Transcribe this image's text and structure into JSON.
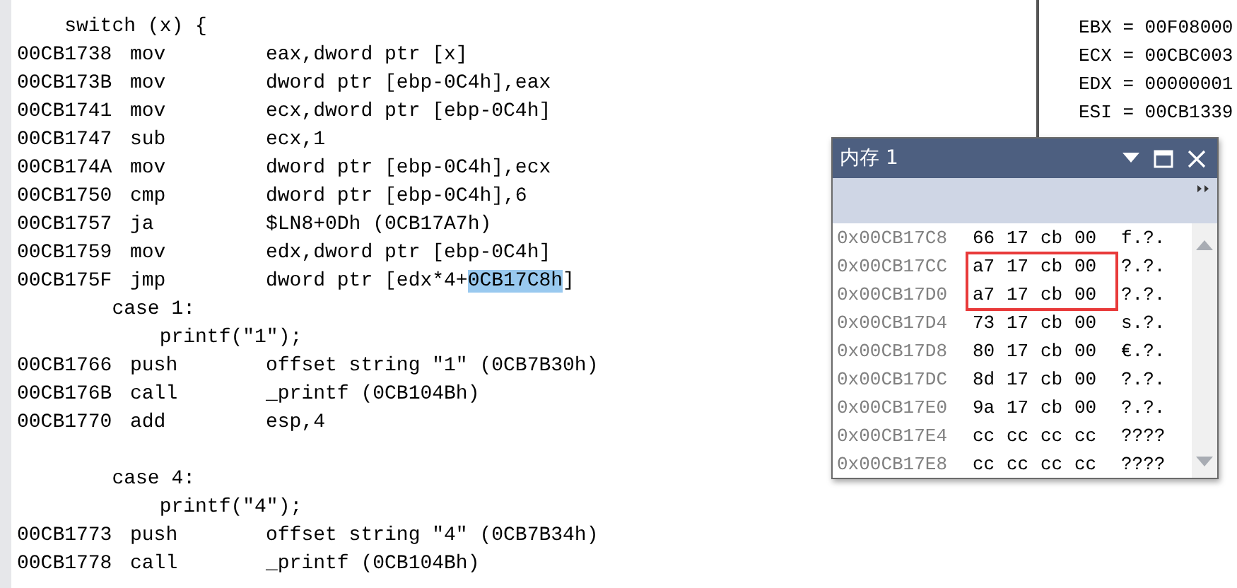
{
  "disassembly": {
    "lines": [
      {
        "kind": "source",
        "text": "    switch (x) {"
      },
      {
        "kind": "asm",
        "address": "00CB1738",
        "mnemonic": "mov",
        "operands": [
          {
            "text": "eax,dword ptr [x]",
            "selected": false
          }
        ]
      },
      {
        "kind": "asm",
        "address": "00CB173B",
        "mnemonic": "mov",
        "operands": [
          {
            "text": "dword ptr [ebp-0C4h],eax",
            "selected": false
          }
        ]
      },
      {
        "kind": "asm",
        "address": "00CB1741",
        "mnemonic": "mov",
        "operands": [
          {
            "text": "ecx,dword ptr [ebp-0C4h]",
            "selected": false
          }
        ]
      },
      {
        "kind": "asm",
        "address": "00CB1747",
        "mnemonic": "sub",
        "operands": [
          {
            "text": "ecx,1",
            "selected": false
          }
        ]
      },
      {
        "kind": "asm",
        "address": "00CB174A",
        "mnemonic": "mov",
        "operands": [
          {
            "text": "dword ptr [ebp-0C4h],ecx",
            "selected": false
          }
        ]
      },
      {
        "kind": "asm",
        "address": "00CB1750",
        "mnemonic": "cmp",
        "operands": [
          {
            "text": "dword ptr [ebp-0C4h],6",
            "selected": false
          }
        ]
      },
      {
        "kind": "asm",
        "address": "00CB1757",
        "mnemonic": "ja",
        "operands": [
          {
            "text": "$LN8+0Dh (0CB17A7h)",
            "selected": false
          }
        ]
      },
      {
        "kind": "asm",
        "address": "00CB1759",
        "mnemonic": "mov",
        "operands": [
          {
            "text": "edx,dword ptr [ebp-0C4h]",
            "selected": false
          }
        ]
      },
      {
        "kind": "asm",
        "address": "00CB175F",
        "mnemonic": "jmp",
        "operands": [
          {
            "text": "dword ptr [edx*4+",
            "selected": false
          },
          {
            "text": "0CB17C8h",
            "selected": true
          },
          {
            "text": "]",
            "selected": false
          }
        ]
      },
      {
        "kind": "source",
        "text": "        case 1:"
      },
      {
        "kind": "source",
        "text": "            printf(″1″);"
      },
      {
        "kind": "asm",
        "address": "00CB1766",
        "mnemonic": "push",
        "operands": [
          {
            "text": "offset string ″1″ (0CB7B30h)",
            "selected": false
          }
        ]
      },
      {
        "kind": "asm",
        "address": "00CB176B",
        "mnemonic": "call",
        "operands": [
          {
            "text": "_printf (0CB104Bh)",
            "selected": false
          }
        ]
      },
      {
        "kind": "asm",
        "address": "00CB1770",
        "mnemonic": "add",
        "operands": [
          {
            "text": "esp,4",
            "selected": false
          }
        ]
      },
      {
        "kind": "blank"
      },
      {
        "kind": "source",
        "text": "        case 4:"
      },
      {
        "kind": "source",
        "text": "            printf(″4″);"
      },
      {
        "kind": "asm",
        "address": "00CB1773",
        "mnemonic": "push",
        "operands": [
          {
            "text": "offset string ″4″ (0CB7B34h)",
            "selected": false
          }
        ]
      },
      {
        "kind": "asm",
        "address": "00CB1778",
        "mnemonic": "call",
        "operands": [
          {
            "text": "_printf (0CB104Bh)",
            "selected": false
          }
        ]
      }
    ]
  },
  "registers": [
    "EBX = 00F08000",
    "ECX = 00CBC003",
    "EDX = 00000001",
    "ESI = 00CB1339"
  ],
  "memory_window": {
    "title": "内存 1",
    "rows": [
      {
        "address": "0x00CB17C8",
        "bytes": [
          "66",
          "17",
          "cb",
          "00"
        ],
        "chars": "f.?.",
        "boxed": false
      },
      {
        "address": "0x00CB17CC",
        "bytes": [
          "a7",
          "17",
          "cb",
          "00"
        ],
        "chars": "?.?.",
        "boxed": true
      },
      {
        "address": "0x00CB17D0",
        "bytes": [
          "a7",
          "17",
          "cb",
          "00"
        ],
        "chars": "?.?.",
        "boxed": true
      },
      {
        "address": "0x00CB17D4",
        "bytes": [
          "73",
          "17",
          "cb",
          "00"
        ],
        "chars": "s.?.",
        "boxed": false
      },
      {
        "address": "0x00CB17D8",
        "bytes": [
          "80",
          "17",
          "cb",
          "00"
        ],
        "chars": "€.?.",
        "boxed": false
      },
      {
        "address": "0x00CB17DC",
        "bytes": [
          "8d",
          "17",
          "cb",
          "00"
        ],
        "chars": "?.?.",
        "boxed": false
      },
      {
        "address": "0x00CB17E0",
        "bytes": [
          "9a",
          "17",
          "cb",
          "00"
        ],
        "chars": "?.?.",
        "boxed": false
      },
      {
        "address": "0x00CB17E4",
        "bytes": [
          "cc",
          "cc",
          "cc",
          "cc"
        ],
        "chars": "????",
        "boxed": false
      },
      {
        "address": "0x00CB17E8",
        "bytes": [
          "cc",
          "cc",
          "cc",
          "cc"
        ],
        "chars": "????",
        "boxed": false
      }
    ]
  }
}
